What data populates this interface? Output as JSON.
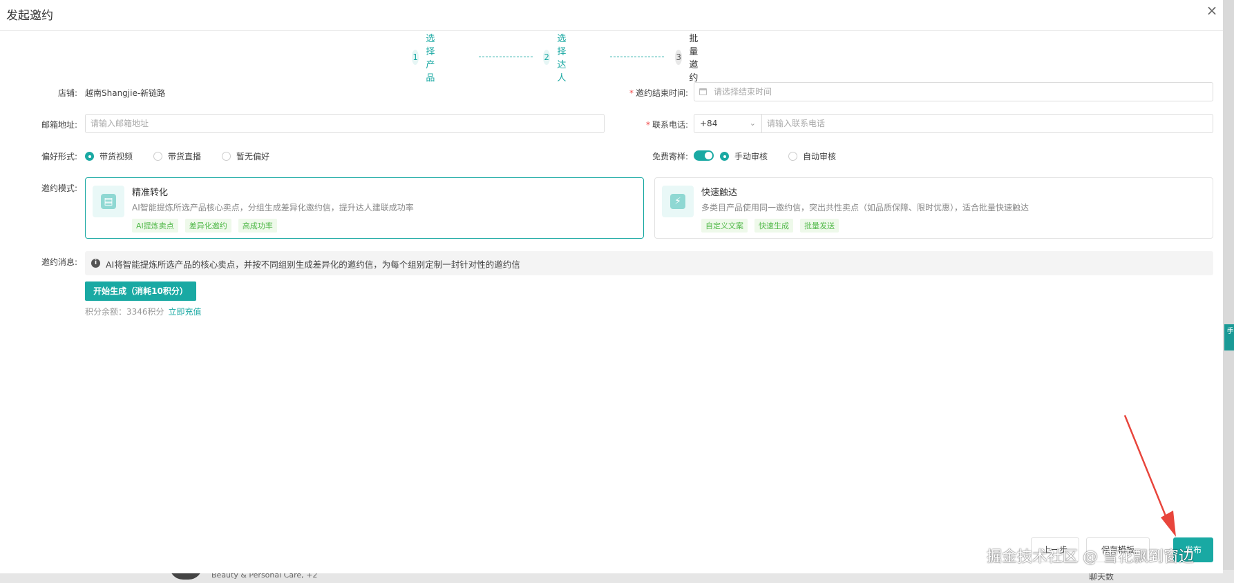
{
  "dialog": {
    "title": "发起邀约",
    "close_icon": "×"
  },
  "steps": [
    {
      "num": "1",
      "label": "选择产品",
      "state": "done"
    },
    {
      "num": "2",
      "label": "选择达人",
      "state": "done"
    },
    {
      "num": "3",
      "label": "批量邀约",
      "state": "current"
    }
  ],
  "form": {
    "shop": {
      "label": "店铺:",
      "value": "越南Shangjie-新链路"
    },
    "end_time": {
      "label": "邀约结束时间:",
      "required": "*",
      "placeholder": "请选择结束时间"
    },
    "email": {
      "label": "邮箱地址:",
      "placeholder": "请输入邮箱地址"
    },
    "phone": {
      "label": "联系电话:",
      "required": "*",
      "country_code": "+84",
      "placeholder": "请输入联系电话"
    },
    "preference": {
      "label": "偏好形式:",
      "options": [
        "带货视频",
        "带货直播",
        "暂无偏好"
      ],
      "selected": "带货视频"
    },
    "free_sample": {
      "label": "免费寄样:",
      "enabled": true,
      "options": [
        "手动审核",
        "自动审核"
      ],
      "selected": "手动审核"
    },
    "mode": {
      "label": "邀约模式:",
      "cards": [
        {
          "title": "精准转化",
          "desc": "AI智能提炼所选产品核心卖点，分组生成差异化邀约信，提升达人建联成功率",
          "tags": [
            "AI提炼卖点",
            "差异化邀约",
            "高成功率"
          ],
          "icon": "document-ai-icon",
          "active": true
        },
        {
          "title": "快速触达",
          "desc": "多类目产品使用同一邀约信，突出共性卖点（如品质保障、限时优惠），适合批量快速触达",
          "tags": [
            "自定义文案",
            "快速生成",
            "批量发送"
          ],
          "icon": "lightning-icon",
          "active": false
        }
      ]
    },
    "message": {
      "label": "邀约消息:",
      "info": "AI将智能提炼所选产品的核心卖点，并按不同组别生成差异化的邀约信，为每个组别定制一封针对性的邀约信"
    }
  },
  "generate_button": "开始生成（消耗10积分）",
  "credits": {
    "text": "积分余额：3346积分",
    "recharge": "立即充值"
  },
  "footer": {
    "prev": "上一步",
    "save": "保存模板",
    "send": "发布"
  },
  "background": {
    "category": "Beauty & Personal Care, +2",
    "chat": "聊天数",
    "side_tab": "手"
  },
  "watermark": "掘金技术社区 @ 雪花飘到窗边",
  "colors": {
    "accent": "#19a9a3",
    "tag_green": "#52b94a",
    "required": "#f04848"
  }
}
